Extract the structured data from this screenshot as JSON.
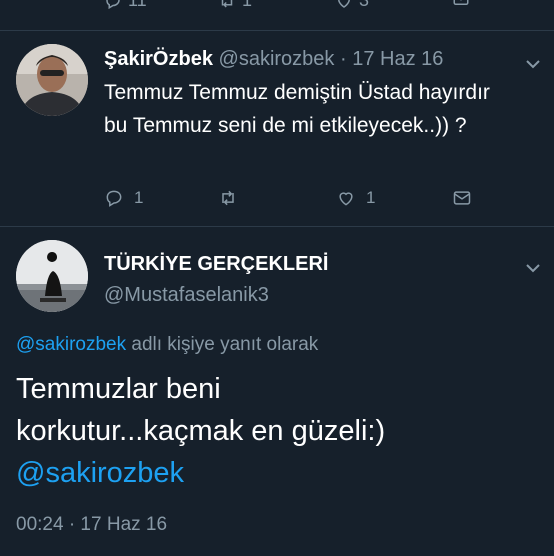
{
  "top_actions": {
    "reply_count": "11",
    "retweet_count": "1",
    "like_count": "3"
  },
  "reply_tweet": {
    "display_name": "ŞakirÖzbek",
    "handle": "@sakirozbek",
    "separator": "·",
    "date": "17 Haz 16",
    "text": "Temmuz Temmuz demiştin Üstad hayırdır bu Temmuz seni de mi etkileyecek..)) ?",
    "actions": {
      "reply_count": "1",
      "retweet_count": "",
      "like_count": "1"
    }
  },
  "main_tweet": {
    "display_name": "TÜRKİYE GERÇEKLERİ",
    "handle": "@Mustafaselanik3",
    "reply_context": {
      "mention": "@sakirozbek",
      "suffix": " adlı kişiye yanıt olarak"
    },
    "text_line1": "Temmuzlar beni",
    "text_line2": "korkutur...kaçmak en güzeli:)",
    "text_mention": "@sakirozbek",
    "timestamp": "00:24 · 17 Haz 16"
  },
  "colors": {
    "background": "#16202b",
    "divider": "#2c3a48",
    "secondary_text": "#8899a6",
    "link": "#1da1f2",
    "primary_text": "#ffffff"
  },
  "icons": [
    "reply-icon",
    "retweet-icon",
    "like-icon",
    "message-icon",
    "chevron-down-icon"
  ]
}
